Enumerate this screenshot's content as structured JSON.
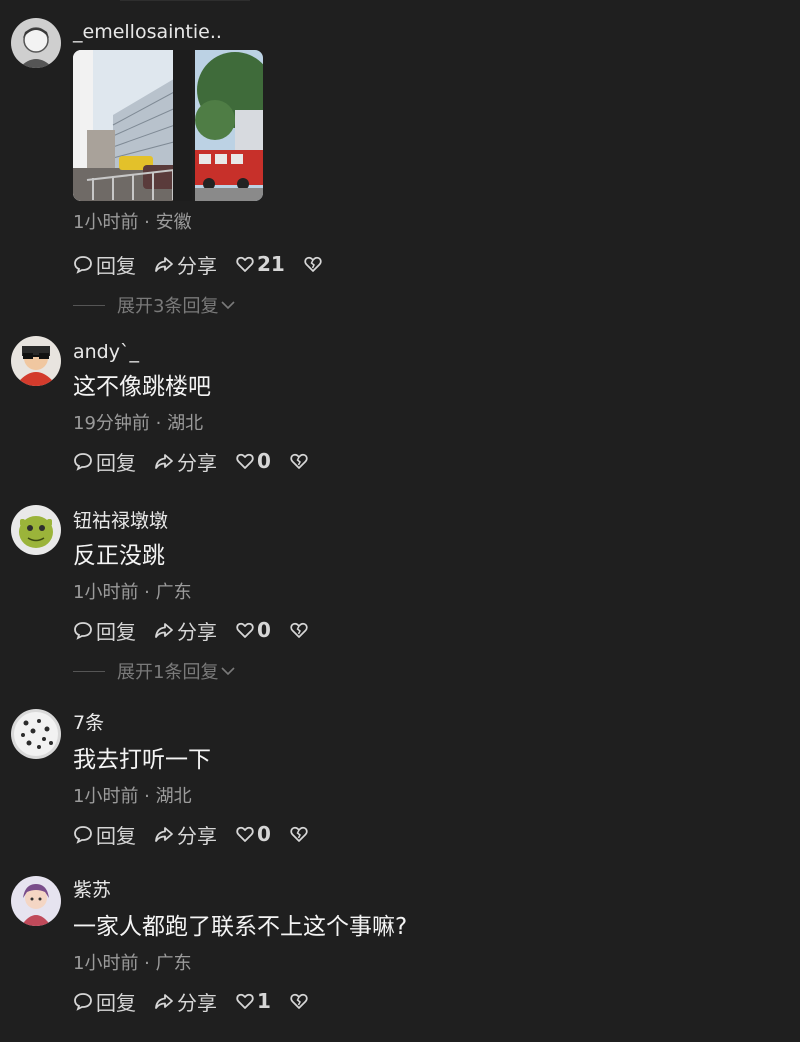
{
  "comments": [
    {
      "username": "_emellosaintie..",
      "images": [
        "building-photo",
        "fire-truck-photo"
      ],
      "meta": "1小时前 · 安徽",
      "reply_label": "回复",
      "share_label": "分享",
      "likes": "21",
      "expand_label": "展开3条回复"
    },
    {
      "username": "andy`_",
      "text": "这不像跳楼吧",
      "meta": "19分钟前 · 湖北",
      "reply_label": "回复",
      "share_label": "分享",
      "likes": "0"
    },
    {
      "username": "钮祜禄墩墩",
      "text": "反正没跳",
      "meta": "1小时前 · 广东",
      "reply_label": "回复",
      "share_label": "分享",
      "likes": "0",
      "expand_label": "展开1条回复"
    },
    {
      "username": "7条",
      "text": "我去打听一下",
      "meta": "1小时前 · 湖北",
      "reply_label": "回复",
      "share_label": "分享",
      "likes": "0"
    },
    {
      "username": "紫苏",
      "text": "一家人都跑了联系不上这个事嘛?",
      "meta": "1小时前 · 广东",
      "reply_label": "回复",
      "share_label": "分享",
      "likes": "1"
    }
  ],
  "icons": {
    "reply": "reply-bubble-icon",
    "share": "share-arrow-icon",
    "like": "heart-icon",
    "dislike": "broken-heart-icon",
    "expand": "chevron-down-icon"
  },
  "colors": {
    "background": "#1f1f1f",
    "text": "#f4f4f4",
    "meta": "#9b9b9b",
    "expand": "#7a7a7a"
  }
}
